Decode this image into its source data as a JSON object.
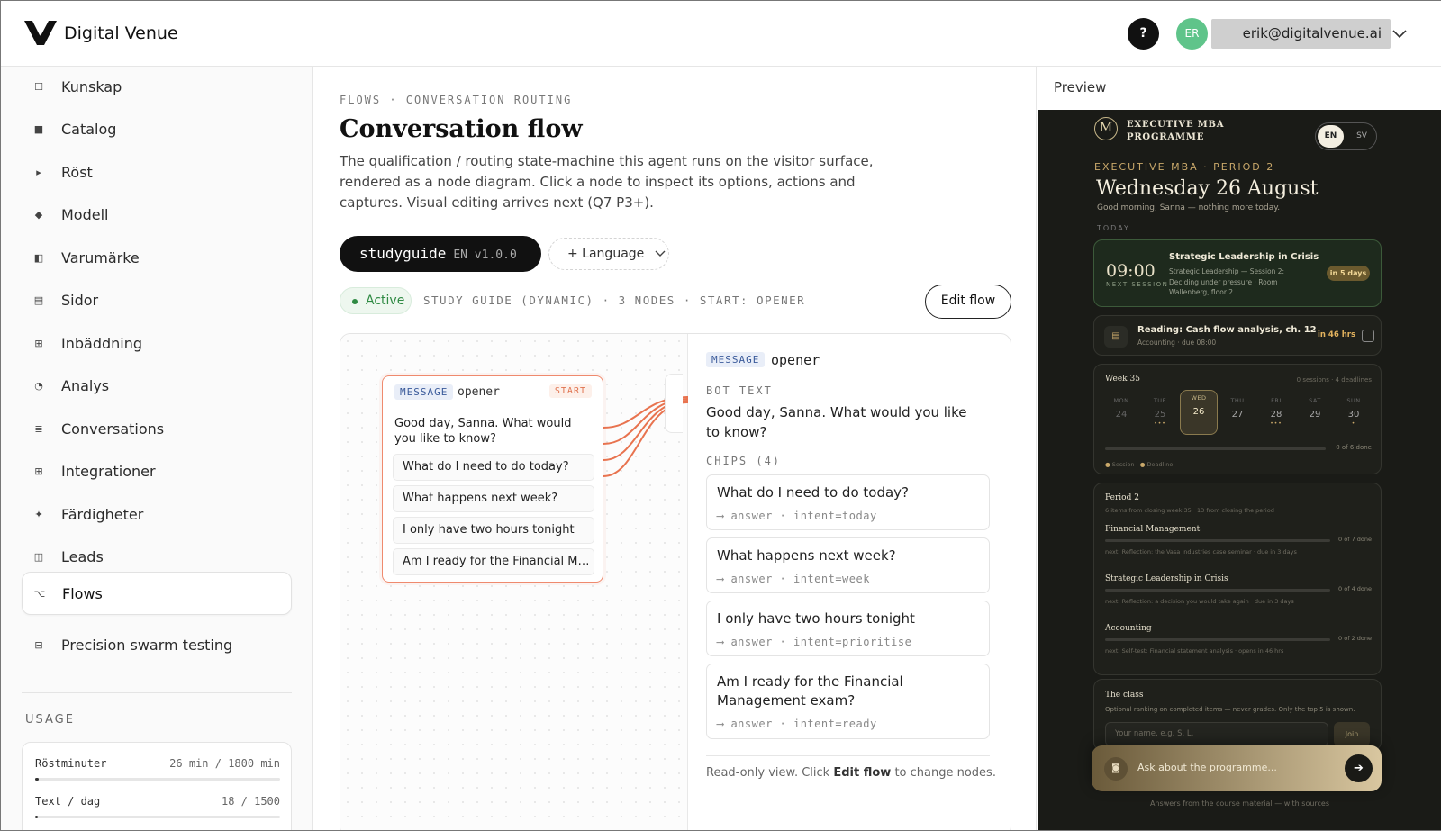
{
  "header": {
    "brand": "Digital Venue",
    "help": "?",
    "avatar_initials": "ER",
    "user_email": "erik@digitalvenue.ai"
  },
  "sidebar": {
    "items": [
      {
        "label": "Kunskap",
        "icon": "square-outline-icon"
      },
      {
        "label": "Catalog",
        "icon": "square-filled-icon"
      },
      {
        "label": "Röst",
        "icon": "play-icon"
      },
      {
        "label": "Modell",
        "icon": "diamond-icon"
      },
      {
        "label": "Varumärke",
        "icon": "half-square-icon"
      },
      {
        "label": "Sidor",
        "icon": "page-icon"
      },
      {
        "label": "Inbäddning",
        "icon": "grid-icon"
      },
      {
        "label": "Analys",
        "icon": "gauge-icon"
      },
      {
        "label": "Conversations",
        "icon": "lines-icon"
      },
      {
        "label": "Integrationer",
        "icon": "plug-grid-icon"
      },
      {
        "label": "Färdigheter",
        "icon": "sparkle-icon"
      },
      {
        "label": "Leads",
        "icon": "columns-icon"
      },
      {
        "label": "Flows",
        "icon": "branch-icon",
        "active": true
      },
      {
        "label": "Precision swarm testing",
        "icon": "stack-icon"
      }
    ],
    "usage": {
      "title": "USAGE",
      "rows": [
        {
          "label": "Röstminuter",
          "value": "26 min / 1800 min",
          "fraction": 0.014
        },
        {
          "label": "Text / dag",
          "value": "18 / 1500",
          "fraction": 0.012
        }
      ]
    }
  },
  "main": {
    "breadcrumb": "FLOWS · CONVERSATION ROUTING",
    "title": "Conversation flow",
    "description": "The qualification / routing state-machine this agent runs on the visitor surface, rendered as a node diagram. Click a node to inspect its options, actions and captures. Visual editing arrives next (Q7 P3+).",
    "flow_tab": {
      "name": "studyguide",
      "sub": "EN v1.0.0"
    },
    "add_language": "+ Language",
    "status": "Active",
    "meta": "STUDY GUIDE (DYNAMIC) · 3 NODES · START: OPENER",
    "edit_flow": "Edit flow",
    "node": {
      "type": "MESSAGE",
      "name": "opener",
      "start": "START",
      "text": "Good day, Sanna. What would you like to know?",
      "chips": [
        "What do I need to do today?",
        "What happens next week?",
        "I only have two hours tonight",
        "Am I ready for the Financial Man..."
      ]
    },
    "inspector": {
      "type": "MESSAGE",
      "name": "opener",
      "bot_text_label": "BOT TEXT",
      "bot_text": "Good day, Sanna. What would you like to know?",
      "chips_label": "CHIPS (4)",
      "chips": [
        {
          "text": "What do I need to do today?",
          "route": "⟶ answer · intent=today"
        },
        {
          "text": "What happens next week?",
          "route": "⟶ answer · intent=week"
        },
        {
          "text": "I only have two hours tonight",
          "route": "⟶ answer · intent=prioritise"
        },
        {
          "text": "Am I ready for the Financial Management exam?",
          "route": "⟶ answer · intent=ready"
        }
      ],
      "note_pre": "Read-only view. Click ",
      "note_bold": "Edit flow",
      "note_post": " to change nodes."
    }
  },
  "preview": {
    "title": "Preview",
    "logo": "M",
    "programme": "EXECUTIVE MBA PROGRAMME",
    "lang_en": "EN",
    "lang_sv": "SV",
    "eyebrow": "EXECUTIVE MBA · PERIOD 2",
    "date": "Wednesday 26 August",
    "greeting": "Good morning, Sanna — nothing more today.",
    "today_label": "TODAY",
    "session": {
      "time": "09:00",
      "next": "NEXT SESSION",
      "title": "Strategic Leadership in Crisis",
      "sub": "Strategic Leadership — Session 2: Deciding under pressure · Room Wallenberg, floor 2",
      "badge": "in 5 days"
    },
    "reading": {
      "title": "Reading: Cash flow analysis, ch. 12",
      "sub": "Accounting · due 08:00",
      "due": "in 46 hrs"
    },
    "week": {
      "title": "Week 35",
      "meta": "0 sessions · 4 deadlines",
      "days": [
        {
          "name": "MON",
          "num": "24",
          "dots": ""
        },
        {
          "name": "TUE",
          "num": "25",
          "dots": "•••"
        },
        {
          "name": "WED",
          "num": "26",
          "dots": ""
        },
        {
          "name": "THU",
          "num": "27",
          "dots": ""
        },
        {
          "name": "FRI",
          "num": "28",
          "dots": "•••"
        },
        {
          "name": "SAT",
          "num": "29",
          "dots": ""
        },
        {
          "name": "SUN",
          "num": "30",
          "dots": "•"
        }
      ],
      "done": "0 of 6 done",
      "legend_session": "Session",
      "legend_deadline": "Deadline"
    },
    "period": {
      "title": "Period 2",
      "sub": "6 items from closing week 35 · 13 from closing the period",
      "courses": [
        {
          "name": "Financial Management",
          "done": "0 of 7 done",
          "next": "next: Reflection: the Vasa Industries case seminar · due in 3 days"
        },
        {
          "name": "Strategic Leadership in Crisis",
          "done": "0 of 4 done",
          "next": "next: Reflection: a decision you would take again · due in 3 days"
        },
        {
          "name": "Accounting",
          "done": "0 of 2 done",
          "next": "next: Self-test: Financial statement analysis · opens in 46 hrs"
        }
      ]
    },
    "class": {
      "title": "The class",
      "sub": "Optional ranking on completed items — never grades. Only the top 5 is shown.",
      "placeholder": "Your name, e.g. S. L.",
      "join": "Join"
    },
    "ask": "Ask about the programme...",
    "footer": "Answers from the course material — with sources"
  }
}
